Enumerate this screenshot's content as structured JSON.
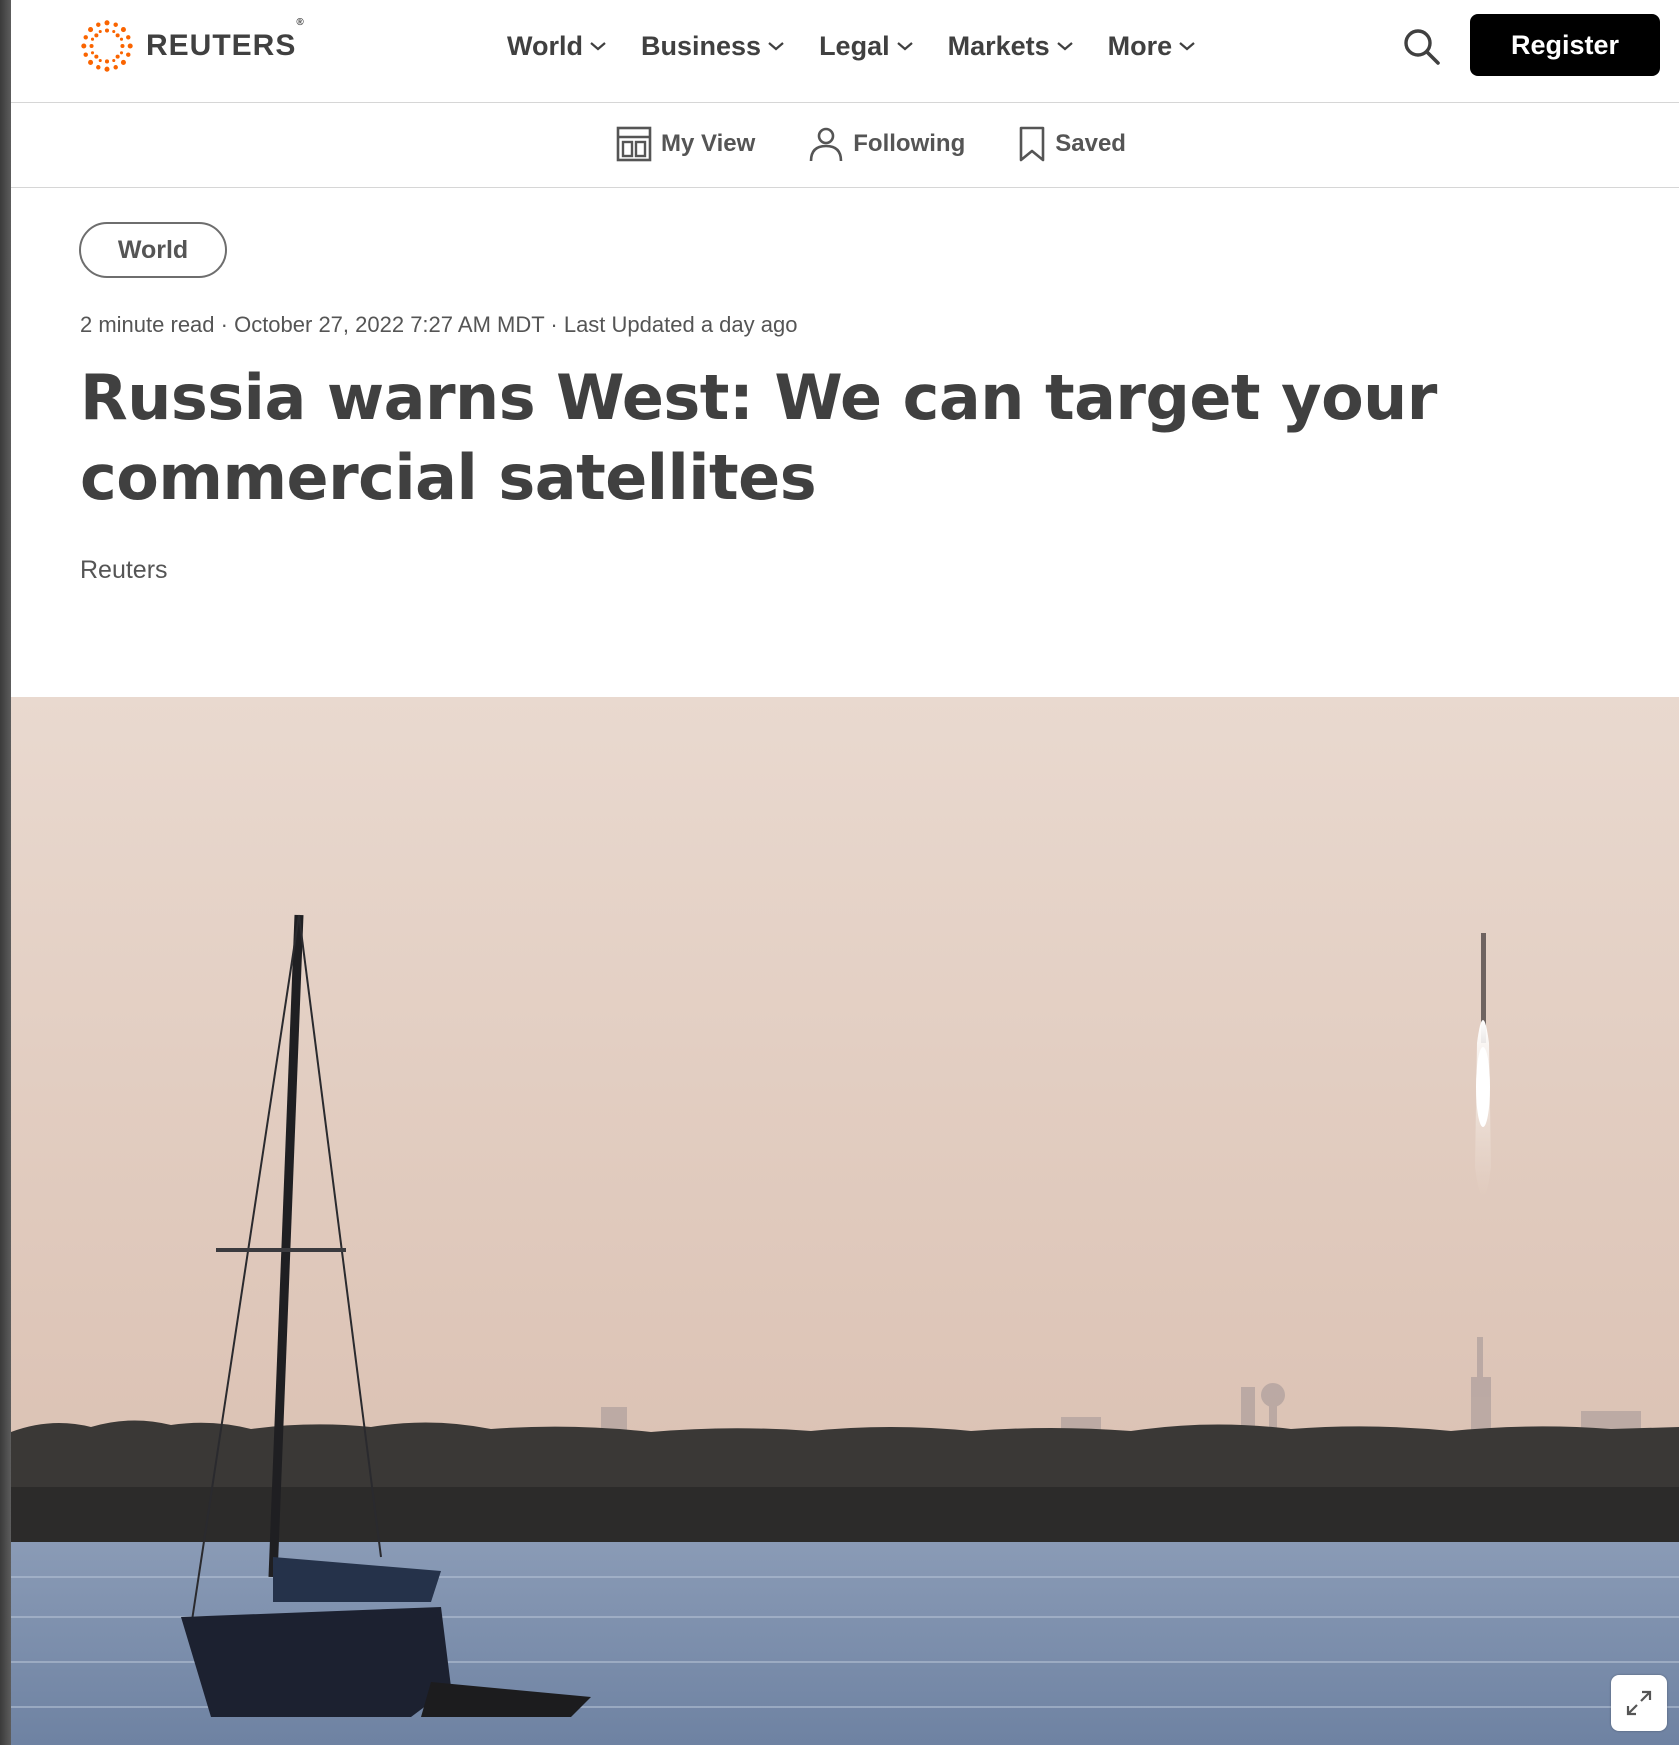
{
  "brand": {
    "name": "REUTERS",
    "registered_mark": "®",
    "accent_color": "#fa6400"
  },
  "nav": {
    "items": [
      {
        "label": "World"
      },
      {
        "label": "Business"
      },
      {
        "label": "Legal"
      },
      {
        "label": "Markets"
      },
      {
        "label": "More"
      }
    ],
    "register_label": "Register"
  },
  "subnav": {
    "items": [
      {
        "label": "My View",
        "icon": "layout-icon"
      },
      {
        "label": "Following",
        "icon": "person-icon"
      },
      {
        "label": "Saved",
        "icon": "bookmark-icon"
      }
    ]
  },
  "article": {
    "section_tag": "World",
    "meta": "2 minute read · October 27, 2022 7:27 AM MDT · Last Updated a day ago",
    "headline": "Russia warns West: We can target your commercial satellites",
    "byline": "Reuters"
  },
  "hero": {
    "sky_top": "#e9d9cf",
    "sky_bottom": "#dcc3b5",
    "water_color": "#7d90ac"
  }
}
